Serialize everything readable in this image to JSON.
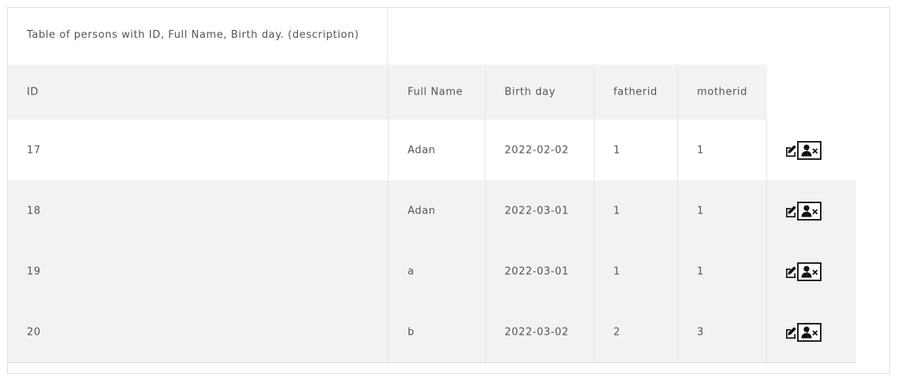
{
  "table": {
    "caption": "Table of persons with ID, Full Name, Birth day. (description)",
    "headers": {
      "id": "ID",
      "full_name": "Full Name",
      "birth_day": "Birth day",
      "fatherid": "fatherid",
      "motherid": "motherid"
    },
    "rows": [
      {
        "id": "17",
        "full_name": "Adan",
        "birth_day": "2022-02-02",
        "fatherid": "1",
        "motherid": "1",
        "separator": "|"
      },
      {
        "id": "18",
        "full_name": "Adan",
        "birth_day": "2022-03-01",
        "fatherid": "1",
        "motherid": "1",
        "separator": "|"
      },
      {
        "id": "19",
        "full_name": "a",
        "birth_day": "2022-03-01",
        "fatherid": "1",
        "motherid": "1",
        "separator": "|"
      },
      {
        "id": "20",
        "full_name": "b",
        "birth_day": "2022-03-02",
        "fatherid": "2",
        "motherid": "3",
        "separator": "|"
      }
    ],
    "actions": {
      "edit_icon": "edit-icon",
      "delete_icon": "user-remove-icon"
    }
  },
  "colors": {
    "header_bg": "#f2f2f2",
    "row_alt_bg": "#f2f2f2",
    "text": "#555555",
    "border": "#dddddd"
  }
}
